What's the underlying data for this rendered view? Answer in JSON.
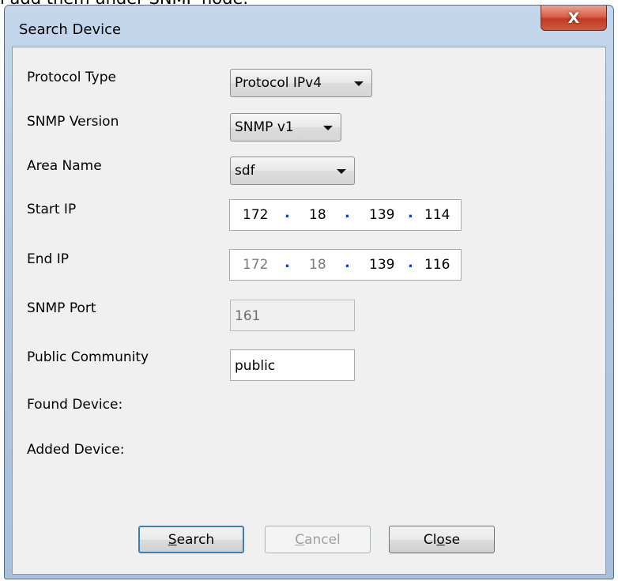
{
  "page_top_text": "i add them under SNMP node.",
  "window": {
    "title": "Search Device"
  },
  "labels": {
    "protocol_type": "Protocol Type",
    "snmp_version": "SNMP Version",
    "area_name": "Area Name",
    "start_ip": "Start IP",
    "end_ip": "End IP",
    "snmp_port": "SNMP Port",
    "public_community": "Public Community",
    "found_device": "Found Device:",
    "added_device": "Added Device:"
  },
  "fields": {
    "protocol_type_value": "Protocol IPv4",
    "snmp_version_value": "SNMP v1",
    "area_name_value": "sdf",
    "start_ip": [
      "172",
      "18",
      "139",
      "114"
    ],
    "end_ip": [
      "172",
      "18",
      "139",
      "116"
    ],
    "snmp_port_value": "161",
    "public_community_value": "public"
  },
  "buttons": {
    "search_prefix": "",
    "search_mnemonic": "S",
    "search_rest": "earch",
    "cancel_mnemonic": "C",
    "cancel_rest": "ancel",
    "close_prefix": "Cl",
    "close_mnemonic": "o",
    "close_rest": "se",
    "title_close_glyph": "X"
  },
  "colors": {
    "title_close_red": "#c23a22",
    "ip_dot_blue": "#1a3cc8"
  }
}
